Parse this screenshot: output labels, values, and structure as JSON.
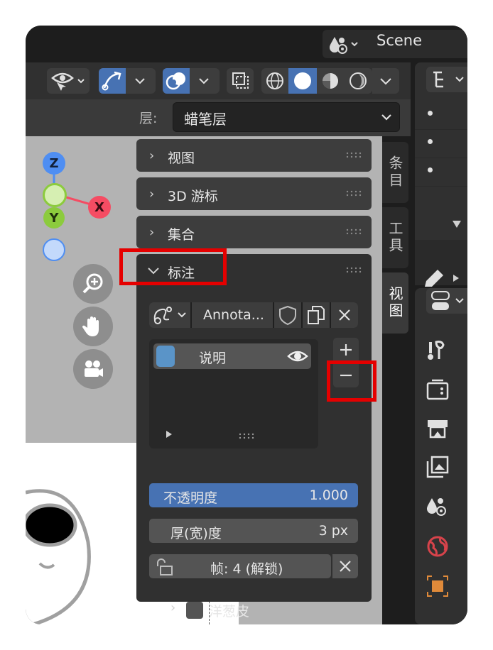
{
  "header": {
    "scene_label": "Scene",
    "layer_label": "层:",
    "layer_value": "蜡笔层"
  },
  "tabs": [
    {
      "label": "条目"
    },
    {
      "label": "工具"
    },
    {
      "label": "视图"
    }
  ],
  "panels": [
    {
      "label": "视图"
    },
    {
      "label": "3D 游标"
    },
    {
      "label": "集合"
    },
    {
      "label": "标注"
    }
  ],
  "annotation": {
    "datablock_name": "Annota...",
    "layers": [
      {
        "name": "说明",
        "color": "#5a94c8"
      }
    ],
    "opacity": {
      "label": "不透明度",
      "value": "1.000"
    },
    "thickness": {
      "label": "厚(宽)度",
      "value": "3 px"
    },
    "frame": {
      "label": "帧: 4 (解锁)"
    },
    "onion": {
      "label": "洋葱皮"
    }
  },
  "gizmo": {
    "z": "Z",
    "x": "X",
    "y": "Y"
  },
  "colors": {
    "accent_blue": "#4772b3",
    "highlight_red": "#e50000",
    "axis_x": "#f54c63",
    "axis_y": "#8ccb3d",
    "axis_z": "#4f8ef2"
  },
  "icons": [
    "visibility-icon",
    "gizmo-icon",
    "overlay-icon",
    "xray-icon",
    "wireframe-icon",
    "solid-icon",
    "material-icon",
    "rendered-icon",
    "zoom-icon",
    "hand-icon",
    "camera-icon",
    "pencil-icon",
    "tool-icon",
    "render-icon",
    "output-icon",
    "image-icon",
    "scene-icon",
    "world-icon",
    "object-icon",
    "shield-icon",
    "copy-icon",
    "close-icon",
    "eye-icon",
    "lock-icon",
    "plus-icon",
    "minus-icon"
  ]
}
